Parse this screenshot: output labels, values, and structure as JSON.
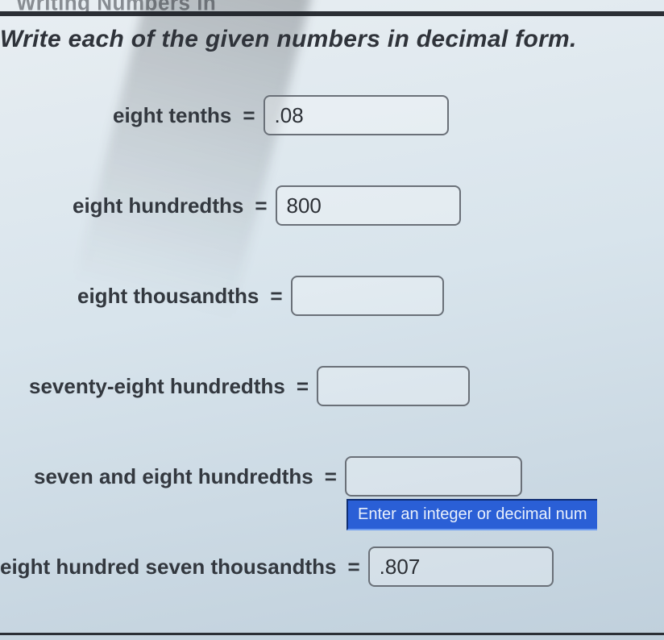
{
  "partial_header": "Writing Numbers in",
  "instruction": "Write each of the given numbers in decimal form.",
  "equals": "=",
  "problems": [
    {
      "label": "eight tenths",
      "value": ".08",
      "focused": false
    },
    {
      "label": "eight hundredths",
      "value": "800",
      "focused": false
    },
    {
      "label": "eight thousandths",
      "value": "",
      "focused": false
    },
    {
      "label": "seventy-eight hundredths",
      "value": "",
      "focused": false
    },
    {
      "label": "seven and eight hundredths",
      "value": "",
      "focused": true
    },
    {
      "label": "eight hundred seven thousandths",
      "value": ".807",
      "focused": false
    }
  ],
  "tooltip": "Enter an integer or decimal num"
}
